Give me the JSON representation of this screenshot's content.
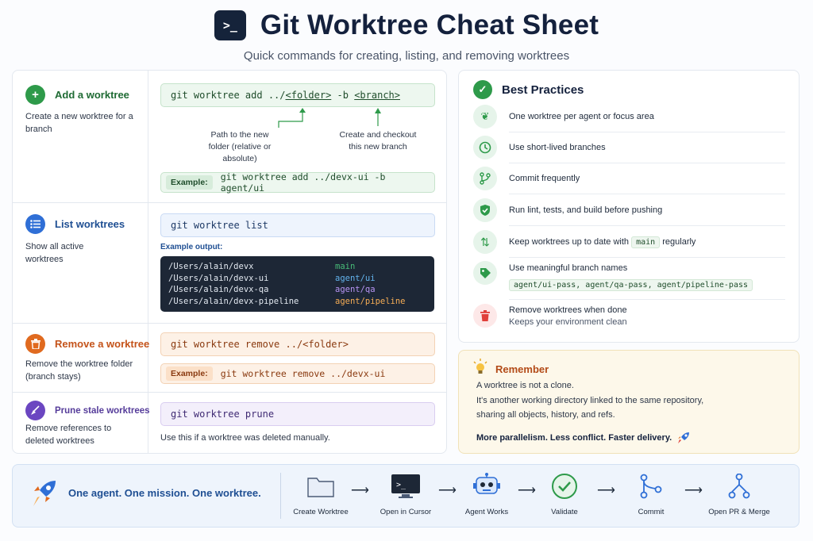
{
  "header": {
    "icon_text": ">_",
    "title": "Git Worktree Cheat Sheet",
    "subtitle": "Quick commands for creating, listing, and removing worktrees"
  },
  "sections": {
    "add": {
      "title": "Add a worktree",
      "desc": "Create a new worktree for a branch",
      "cmd_prefix": "git worktree add ../",
      "cmd_folder": "<folder>",
      "cmd_mid": " -b ",
      "cmd_branch": "<branch>",
      "annot_folder": "Path to the new folder (relative or absolute)",
      "annot_branch": "Create and checkout this new branch",
      "example_label": "Example:",
      "example_cmd": "git worktree add ../devx-ui -b agent/ui",
      "color": "#2e9a4a"
    },
    "list": {
      "title": "List worktrees",
      "desc": "Show all active worktrees",
      "cmd": "git worktree list",
      "output_label": "Example output:",
      "output": [
        {
          "path": "/Users/alain/devx",
          "branch": "main",
          "color": "#48bb78"
        },
        {
          "path": "/Users/alain/devx-ui",
          "branch": "agent/ui",
          "color": "#63b3ed"
        },
        {
          "path": "/Users/alain/devx-qa",
          "branch": "agent/qa",
          "color": "#b794f4"
        },
        {
          "path": "/Users/alain/devx-pipeline",
          "branch": "agent/pipeline",
          "color": "#f6ad55"
        }
      ],
      "color": "#2f6fd6"
    },
    "remove": {
      "title": "Remove a worktree",
      "desc": "Remove the worktree folder (branch stays)",
      "cmd": "git worktree remove ../<folder>",
      "example_label": "Example:",
      "example_cmd": "git worktree remove ../devx-ui",
      "color": "#e06a1f"
    },
    "prune": {
      "title": "Prune stale worktrees",
      "desc": "Remove references to deleted worktrees",
      "cmd": "git worktree prune",
      "note": "Use this if a worktree was deleted manually.",
      "color": "#6b46c1"
    }
  },
  "best_practices": {
    "title": "Best Practices",
    "items": [
      {
        "text": "One worktree per agent or focus area",
        "icon": "leaf-icon"
      },
      {
        "text": "Use short-lived branches",
        "icon": "clock-icon"
      },
      {
        "text": "Commit frequently",
        "icon": "branch-icon"
      },
      {
        "text": "Run lint, tests, and build before pushing",
        "icon": "shield-check-icon"
      },
      {
        "text_before": "Keep worktrees up to date with ",
        "chip": "main",
        "text_after": " regularly",
        "icon": "sync-arrows-icon"
      },
      {
        "text": "Use meaningful branch names",
        "chip": "agent/ui-pass, agent/qa-pass, agent/pipeline-pass",
        "icon": "tag-icon"
      },
      {
        "text": "Remove worktrees when done",
        "subtext": "Keeps your environment clean",
        "icon": "trash-icon"
      }
    ]
  },
  "remember": {
    "title": "Remember",
    "line1": "A worktree is not a clone.",
    "line2": "It's another working directory linked to the same repository,",
    "line3": "sharing all objects, history, and refs.",
    "tagline": "More parallelism. Less conflict. Faster delivery."
  },
  "flow": {
    "mission": "One agent. One mission. One worktree.",
    "steps": [
      "Create Worktree",
      "Open in Cursor",
      "Agent Works",
      "Validate",
      "Commit",
      "Open PR & Merge"
    ]
  }
}
